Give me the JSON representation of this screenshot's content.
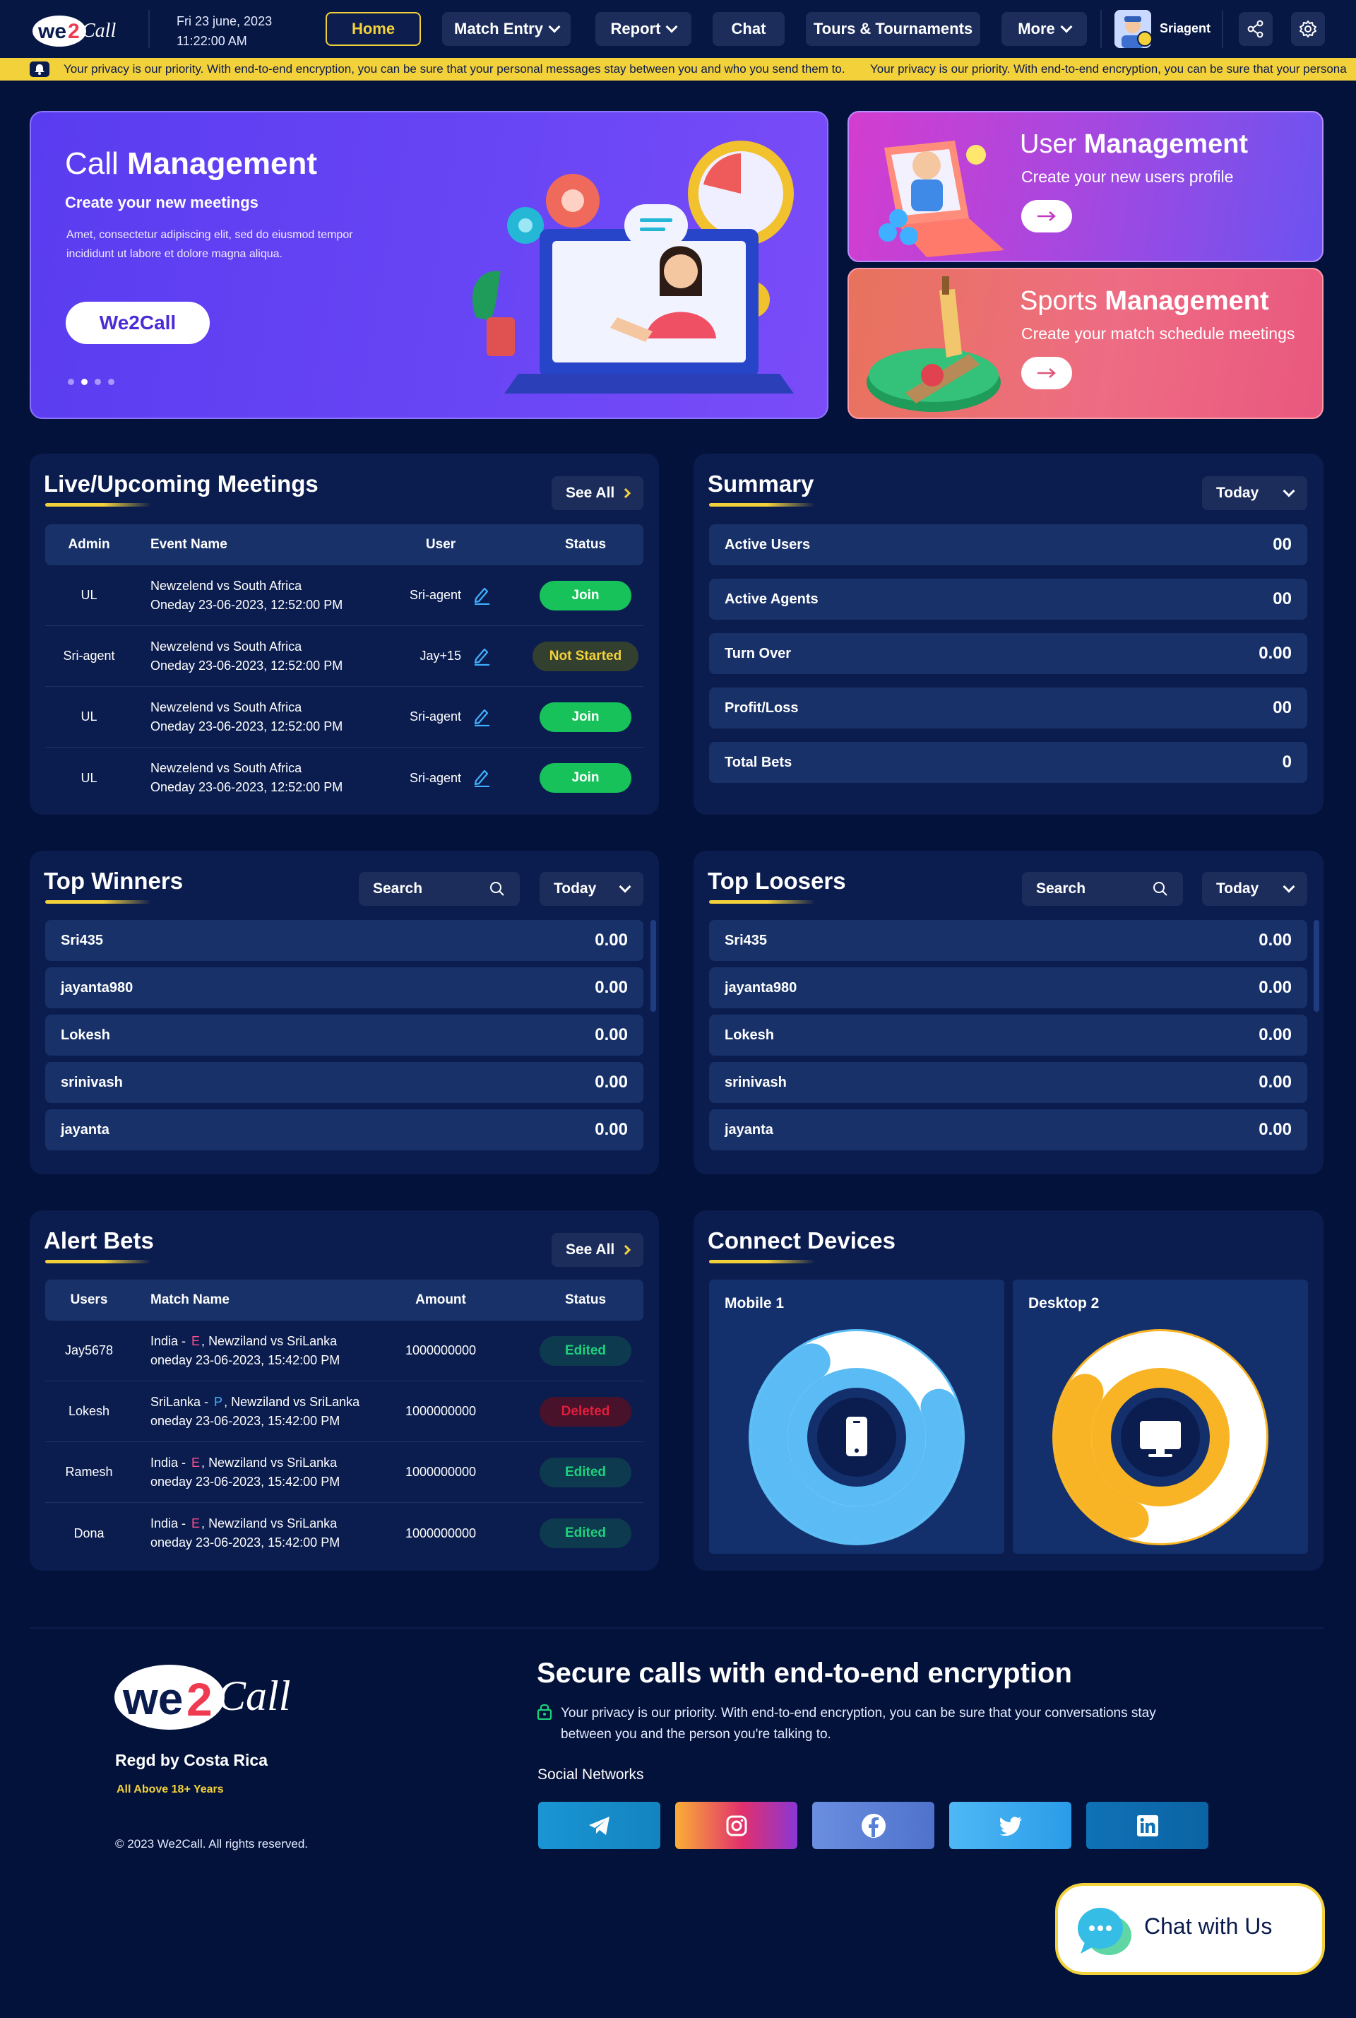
{
  "header": {
    "brand": "we2Call",
    "date": "Fri 23 june, 2023",
    "time": "11:22:00 AM",
    "nav": [
      {
        "label": "Home",
        "active": true,
        "dropdown": false
      },
      {
        "label": "Match Entry",
        "active": false,
        "dropdown": true
      },
      {
        "label": "Report",
        "active": false,
        "dropdown": true
      },
      {
        "label": "Chat",
        "active": false,
        "dropdown": false
      },
      {
        "label": "Tours & Tournaments",
        "active": false,
        "dropdown": false
      },
      {
        "label": "More",
        "active": false,
        "dropdown": true
      }
    ],
    "username": "Sriagent",
    "icons": [
      "share-icon",
      "settings-icon"
    ]
  },
  "ticker": {
    "icon": "notification-bell-icon",
    "text": "Your privacy is our priority. With end-to-end encryption, you can be sure that your personal messages stay between you and who you send them to.",
    "text_repeat": "Your privacy is our priority. With end-to-end encryption, you can be sure that your persona"
  },
  "banners": {
    "main": {
      "title_light": "Call ",
      "title_bold": "Management",
      "subtitle": "Create your new meetings",
      "description": "Amet, consectetur adipiscing elit, sed do eiusmod tempor incididunt ut labore et dolore magna aliqua.",
      "button": "We2Call",
      "slide_count": 4,
      "active_slide": 2
    },
    "user": {
      "title_light": "User ",
      "title_bold": "Management",
      "subtitle": "Create your new users profile"
    },
    "sports": {
      "title_light": "Sports ",
      "title_bold": "Management",
      "subtitle": "Create your match schedule meetings"
    }
  },
  "meetings": {
    "title": "Live/Upcoming Meetings",
    "see_all": "See All",
    "columns": [
      "Admin",
      "Event Name",
      "User",
      "Status"
    ],
    "rows": [
      {
        "admin": "UL",
        "event": "Newzelend vs South Africa",
        "date": "Oneday 23-06-2023, 12:52:00 PM",
        "user": "Sri-agent",
        "status": "Join"
      },
      {
        "admin": "Sri-agent",
        "event": "Newzelend vs South Africa",
        "date": "Oneday 23-06-2023, 12:52:00 PM",
        "user": "Jay+15",
        "status": "Not Started"
      },
      {
        "admin": "UL",
        "event": "Newzelend vs South Africa",
        "date": "Oneday 23-06-2023, 12:52:00 PM",
        "user": "Sri-agent",
        "status": "Join"
      },
      {
        "admin": "UL",
        "event": "Newzelend vs South Africa",
        "date": "Oneday 23-06-2023, 12:52:00 PM",
        "user": "Sri-agent",
        "status": "Join"
      }
    ]
  },
  "summary": {
    "title": "Summary",
    "filter": "Today",
    "rows": [
      {
        "label": "Active Users",
        "value": "00"
      },
      {
        "label": "Active Agents",
        "value": "00"
      },
      {
        "label": "Turn Over",
        "value": "0.00"
      },
      {
        "label": "Profit/Loss",
        "value": "00"
      },
      {
        "label": "Total Bets",
        "value": "0"
      }
    ]
  },
  "top_winners": {
    "title": "Top Winners",
    "search_placeholder": "Search",
    "filter": "Today",
    "rows": [
      {
        "name": "Sri435",
        "value": "0.00"
      },
      {
        "name": "jayanta980",
        "value": "0.00"
      },
      {
        "name": "Lokesh",
        "value": "0.00"
      },
      {
        "name": "srinivash",
        "value": "0.00"
      },
      {
        "name": "jayanta",
        "value": "0.00"
      }
    ]
  },
  "top_loosers": {
    "title": "Top Loosers",
    "search_placeholder": "Search",
    "filter": "Today",
    "rows": [
      {
        "name": "Sri435",
        "value": "0.00"
      },
      {
        "name": "jayanta980",
        "value": "0.00"
      },
      {
        "name": "Lokesh",
        "value": "0.00"
      },
      {
        "name": "srinivash",
        "value": "0.00"
      },
      {
        "name": "jayanta",
        "value": "0.00"
      }
    ]
  },
  "alert_bets": {
    "title": "Alert Bets",
    "see_all": "See All",
    "columns": [
      "Users",
      "Match Name",
      "Amount",
      "Status"
    ],
    "rows": [
      {
        "user": "Jay5678",
        "country": "India -",
        "tag": "E",
        "tag_color": "#ff4f8b",
        "match": "Newziland vs SriLanka",
        "date": "oneday 23-06-2023, 15:42:00 PM",
        "amount": "1000000000",
        "status": "Edited"
      },
      {
        "user": "Lokesh",
        "country": "SriLanka -",
        "tag": "P",
        "tag_color": "#3fb0ff",
        "match": "Newziland vs SriLanka",
        "date": "oneday 23-06-2023, 15:42:00 PM",
        "amount": "1000000000",
        "status": "Deleted"
      },
      {
        "user": "Ramesh",
        "country": "India -",
        "tag": "E",
        "tag_color": "#ff4f8b",
        "match": "Newziland vs SriLanka",
        "date": "oneday 23-06-2023, 15:42:00 PM",
        "amount": "1000000000",
        "status": "Edited"
      },
      {
        "user": "Dona",
        "country": "India -",
        "tag": "E",
        "tag_color": "#ff4f8b",
        "match": "Newziland vs SriLanka",
        "date": "oneday 23-06-2023, 15:42:00 PM",
        "amount": "1000000000",
        "status": "Edited"
      }
    ]
  },
  "connect_devices": {
    "title": "Connect Devices",
    "devices": [
      {
        "label": "Mobile 1",
        "icon": "mobile-phone-icon",
        "color": "#5bbcf5",
        "share": 0.72
      },
      {
        "label": "Desktop 2",
        "icon": "desktop-monitor-icon",
        "color": "#f8b425",
        "share": 0.28
      }
    ]
  },
  "footer": {
    "brand": "we2Call",
    "registered": "Regd by Costa Rica",
    "age": "All Above 18+ Years",
    "copyright": "© 2023 We2Call. All rights reserved.",
    "secure_title": "Secure calls with end-to-end encryption",
    "secure_desc": "Your privacy is our priority. With end-to-end encryption, you can be sure that your conversations stay between you and the person you're talking to.",
    "social_title": "Social Networks",
    "socials": [
      {
        "name": "telegram-icon",
        "color": "#1a95d4"
      },
      {
        "name": "instagram-icon",
        "color": "#e1306c"
      },
      {
        "name": "facebook-icon",
        "color": "#5a7fd6"
      },
      {
        "name": "twitter-icon",
        "color": "#34a9f2"
      },
      {
        "name": "linkedin-icon",
        "color": "#0f72b6"
      }
    ]
  },
  "chat_widget": {
    "label": "Chat with Us"
  },
  "colors": {
    "background": "#03123a",
    "card": "#0b1d4f",
    "accent": "#f3d13b",
    "row": "#183269"
  }
}
